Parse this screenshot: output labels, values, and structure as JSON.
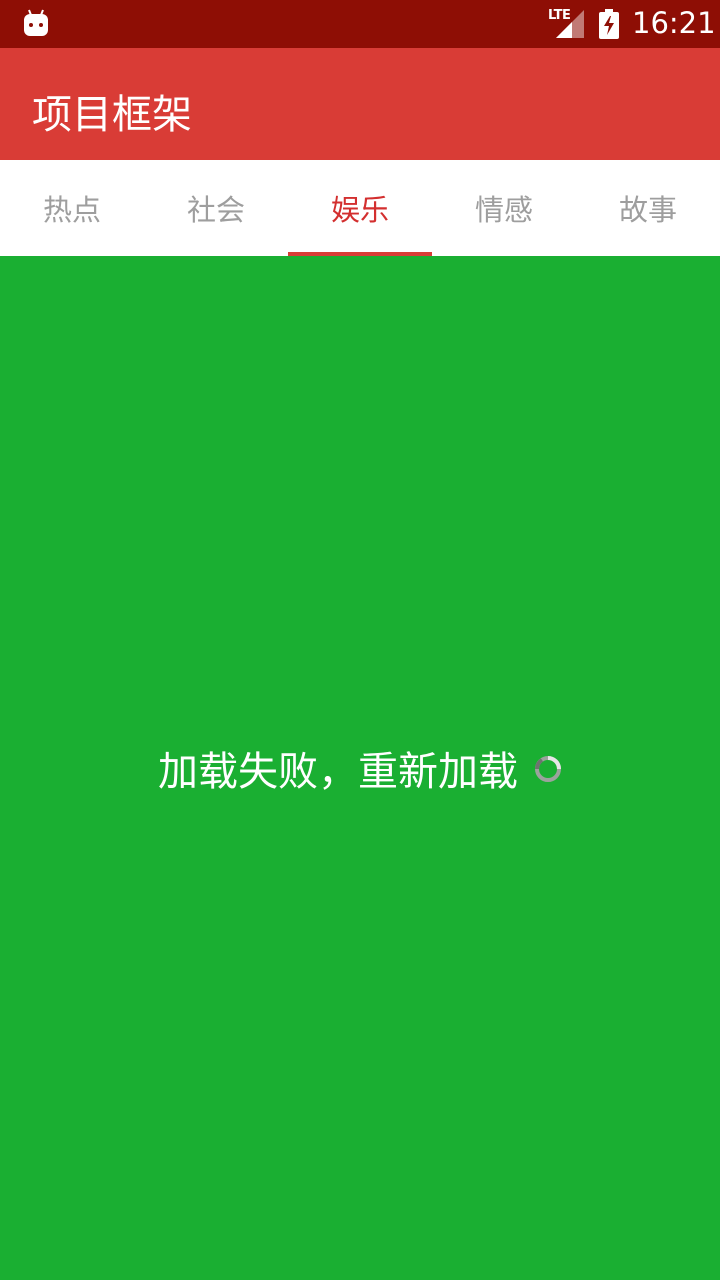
{
  "status_bar": {
    "time": "16:21",
    "network_label": "LTE",
    "icons": [
      "android-icon",
      "lte-signal-icon",
      "battery-charging-icon"
    ]
  },
  "app_bar": {
    "title": "项目框架"
  },
  "tabs": [
    {
      "label": "热点",
      "active": false
    },
    {
      "label": "社会",
      "active": false
    },
    {
      "label": "娱乐",
      "active": true
    },
    {
      "label": "情感",
      "active": false
    },
    {
      "label": "故事",
      "active": false
    }
  ],
  "content": {
    "message": "加载失败，重新加载",
    "icon": "loading-spinner-icon"
  },
  "colors": {
    "status_bar": "#8E0E05",
    "app_bar": "#D93C36",
    "tab_active": "#D32F2F",
    "tab_inactive": "#9E9E9E",
    "content_bg": "#1AAF32"
  }
}
